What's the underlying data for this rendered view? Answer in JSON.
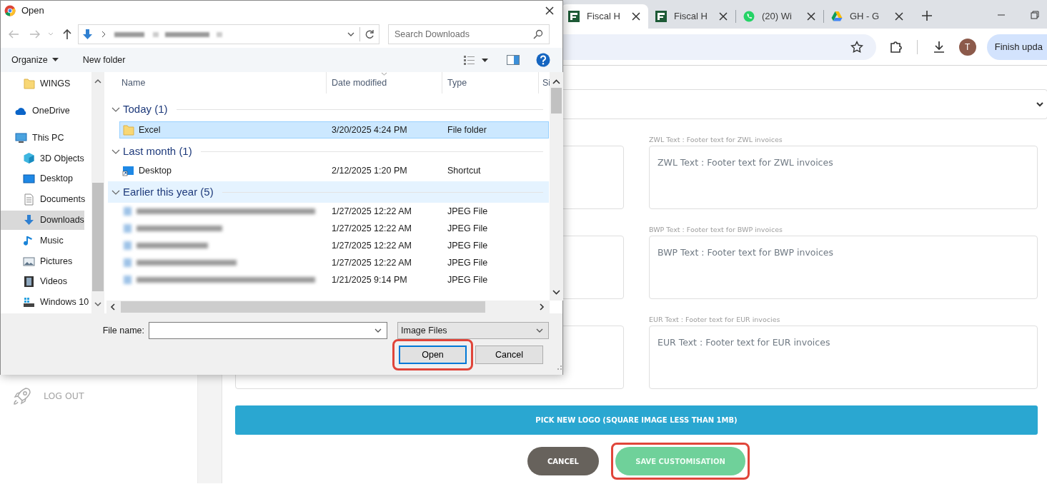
{
  "browser": {
    "tabs": [
      {
        "title": "Fiscal H",
        "kind": "fiscal",
        "selected": true
      },
      {
        "title": "Fiscal H",
        "kind": "fiscal",
        "selected": false
      },
      {
        "title": "(20) Wi",
        "kind": "whatsapp",
        "selected": false
      },
      {
        "title": "GH - G",
        "kind": "drive",
        "selected": false
      }
    ],
    "avatar": "T",
    "update_button": "Finish upda"
  },
  "sidebar": {
    "items": [
      {
        "label": "LOG OUT"
      }
    ]
  },
  "form": {
    "rows": [
      {
        "label": "ZWL Text : Footer text for ZWL invoices",
        "placeholder": "ZWL Text : Footer text for ZWL invoices"
      },
      {
        "label": "BWP Text : Footer text for BWP invoices",
        "placeholder": "BWP Text : Footer text for BWP invoices"
      },
      {
        "label": "EUR Text : Footer text for EUR invocies",
        "placeholder": "EUR Text : Footer text for EUR invoices"
      }
    ],
    "pick_logo": "PICK NEW LOGO (SQUARE IMAGE LESS THAN 1MB)",
    "buttons": [
      {
        "label": "CANCEL",
        "kind": "cancel",
        "highlighted": false
      },
      {
        "label": "SAVE CUSTOMISATION",
        "kind": "save",
        "highlighted": true
      }
    ]
  },
  "dialog": {
    "title": "Open",
    "search": {
      "placeholder": "Search Downloads"
    },
    "commands": [
      {
        "label": "Organize",
        "dropdown": true
      },
      {
        "label": "New folder",
        "dropdown": false
      }
    ],
    "nav": [
      {
        "children": [
          {
            "label": "WINGS",
            "kind": "folder",
            "selected": false
          }
        ]
      },
      {
        "label": "OneDrive",
        "kind": "cloud",
        "selected": false
      },
      {
        "label": "This PC",
        "kind": "pc",
        "selected": false,
        "children": [
          {
            "label": "3D Objects",
            "kind": "cube",
            "selected": false
          },
          {
            "label": "Desktop",
            "kind": "desktop",
            "selected": false
          },
          {
            "label": "Documents",
            "kind": "document",
            "selected": false
          },
          {
            "label": "Downloads",
            "kind": "download",
            "selected": true
          },
          {
            "label": "Music",
            "kind": "music",
            "selected": false
          },
          {
            "label": "Pictures",
            "kind": "pictures",
            "selected": false
          },
          {
            "label": "Videos",
            "kind": "video",
            "selected": false
          },
          {
            "label": "Windows 10",
            "kind": "drive",
            "selected": false
          }
        ]
      }
    ],
    "columns": [
      "Name",
      "Date modified",
      "Type",
      "Si"
    ],
    "groups": [
      {
        "label": "Today (1)",
        "hovered": false,
        "files": [
          {
            "name": "Excel",
            "kind": "folder",
            "date": "3/20/2025 4:24 PM",
            "type": "File folder",
            "selected": true
          }
        ]
      },
      {
        "label": "Last month (1)",
        "hovered": false,
        "files": [
          {
            "name": "Desktop",
            "kind": "shortcut",
            "date": "2/12/2025 1:20 PM",
            "type": "Shortcut",
            "selected": false
          }
        ]
      },
      {
        "label": "Earlier this year (5)",
        "hovered": true,
        "files": [
          {
            "kind": "image",
            "date": "1/27/2025 12:22 AM",
            "type": "JPEG File",
            "selected": false
          },
          {
            "kind": "image",
            "date": "1/27/2025 12:22 AM",
            "type": "JPEG File",
            "selected": false
          },
          {
            "kind": "image",
            "date": "1/27/2025 12:22 AM",
            "type": "JPEG File",
            "selected": false
          },
          {
            "kind": "image",
            "date": "1/27/2025 12:22 AM",
            "type": "JPEG File",
            "selected": false
          },
          {
            "kind": "image",
            "date": "1/21/2025 9:14 PM",
            "type": "JPEG File",
            "selected": false
          }
        ]
      }
    ],
    "file_name": {
      "label": "File name:"
    },
    "file_type": "Image Files",
    "buttons": [
      {
        "label": "Open",
        "default": true,
        "highlighted": true
      },
      {
        "label": "Cancel",
        "default": false,
        "highlighted": false
      }
    ]
  }
}
